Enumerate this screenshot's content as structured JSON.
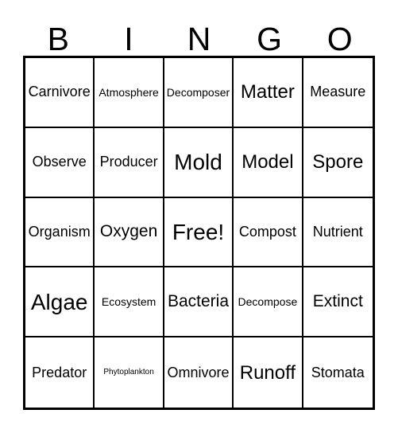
{
  "card": {
    "title": "BINGO",
    "header_letters": [
      "B",
      "I",
      "N",
      "G",
      "O"
    ],
    "colors": {
      "background": "#ffffff",
      "text": "#000000",
      "grid_line": "#000000"
    },
    "grid": {
      "rows": 5,
      "columns": 5,
      "free_space_label": "Free!",
      "free_space_position": "N3"
    },
    "cells": [
      {
        "text": "Carnivore",
        "size": "m"
      },
      {
        "text": "Atmosphere",
        "size": "s"
      },
      {
        "text": "Decomposer",
        "size": "s"
      },
      {
        "text": "Matter",
        "size": "xl"
      },
      {
        "text": "Measure",
        "size": "m"
      },
      {
        "text": "Observe",
        "size": "m"
      },
      {
        "text": "Producer",
        "size": "m"
      },
      {
        "text": "Mold",
        "size": "xxl"
      },
      {
        "text": "Model",
        "size": "xl"
      },
      {
        "text": "Spore",
        "size": "xl"
      },
      {
        "text": "Organism",
        "size": "m"
      },
      {
        "text": "Oxygen",
        "size": "l"
      },
      {
        "text": "Free!",
        "size": "xxl"
      },
      {
        "text": "Compost",
        "size": "m"
      },
      {
        "text": "Nutrient",
        "size": "m"
      },
      {
        "text": "Algae",
        "size": "xxl"
      },
      {
        "text": "Ecosystem",
        "size": "s"
      },
      {
        "text": "Bacteria",
        "size": "l"
      },
      {
        "text": "Decompose",
        "size": "s"
      },
      {
        "text": "Extinct",
        "size": "l"
      },
      {
        "text": "Predator",
        "size": "m"
      },
      {
        "text": "Phytoplankton",
        "size": "xxs"
      },
      {
        "text": "Omnivore",
        "size": "m"
      },
      {
        "text": "Runoff",
        "size": "xl"
      },
      {
        "text": "Stomata",
        "size": "m"
      }
    ]
  }
}
